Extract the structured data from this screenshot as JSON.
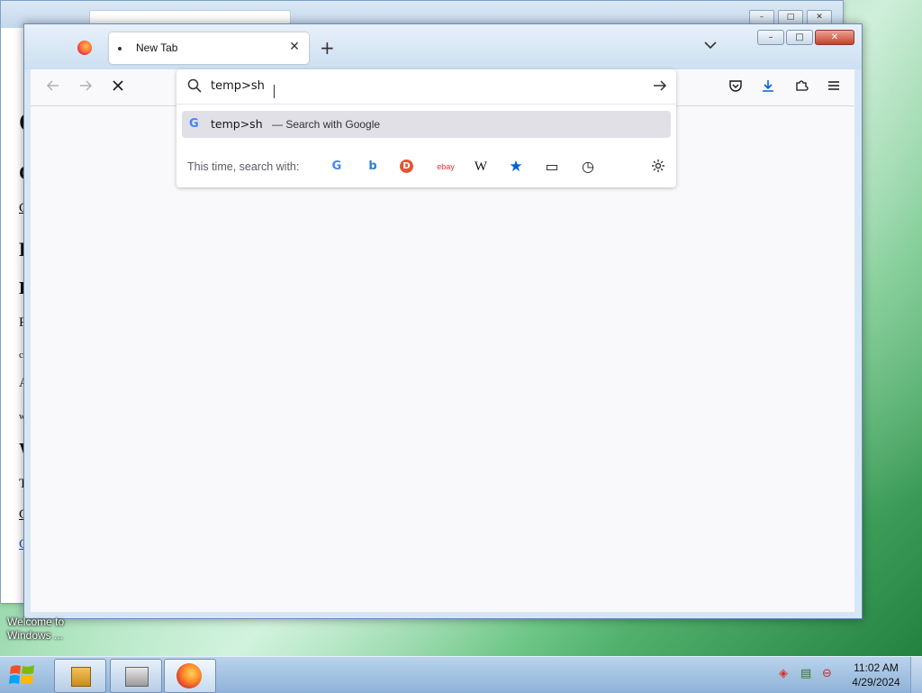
{
  "desktop": {
    "welcome_label": "Welcome to Windows ...",
    "background_colors": [
      "#0f6b2a",
      "#8fd5a4",
      "#c7ecd4"
    ]
  },
  "background_window": {
    "visible_fragments": [
      "C",
      "C",
      "C",
      "F",
      "L",
      "F",
      "c",
      "A",
      "w",
      "W",
      "T",
      "C",
      "C"
    ],
    "controls": {
      "minimize": "–",
      "maximize": "□",
      "close": "✕"
    }
  },
  "browser": {
    "tabs": [
      {
        "label": "New Tab"
      }
    ],
    "new_tab_icon": "plus-icon",
    "list_tabs_icon": "chevron-down-icon",
    "window_controls": {
      "minimize": "–",
      "maximize": "□",
      "close": "✕"
    },
    "toolbar": {
      "left_icons": [
        "back-arrow-icon",
        "forward-arrow-icon",
        "stop-loading-icon"
      ],
      "right_icons": [
        "pocket-icon",
        "download-icon",
        "extensions-icon",
        "menu-icon"
      ]
    },
    "urlbar": {
      "value": "temp>sh",
      "go_icon": "arrow-right-icon",
      "suggestion": {
        "engine_icon": "google-icon",
        "text": "temp>sh",
        "action": "— Search with Google"
      },
      "one_off": {
        "label": "This time, search with:",
        "engines": [
          "G",
          "b",
          "D",
          "ebay",
          "W",
          "★",
          "▭",
          "◷"
        ],
        "settings_icon": "gear-icon"
      }
    },
    "accent_color": "#0060df"
  },
  "taskbar": {
    "clock_time": "11:02 AM",
    "clock_date": "4/29/2024"
  }
}
